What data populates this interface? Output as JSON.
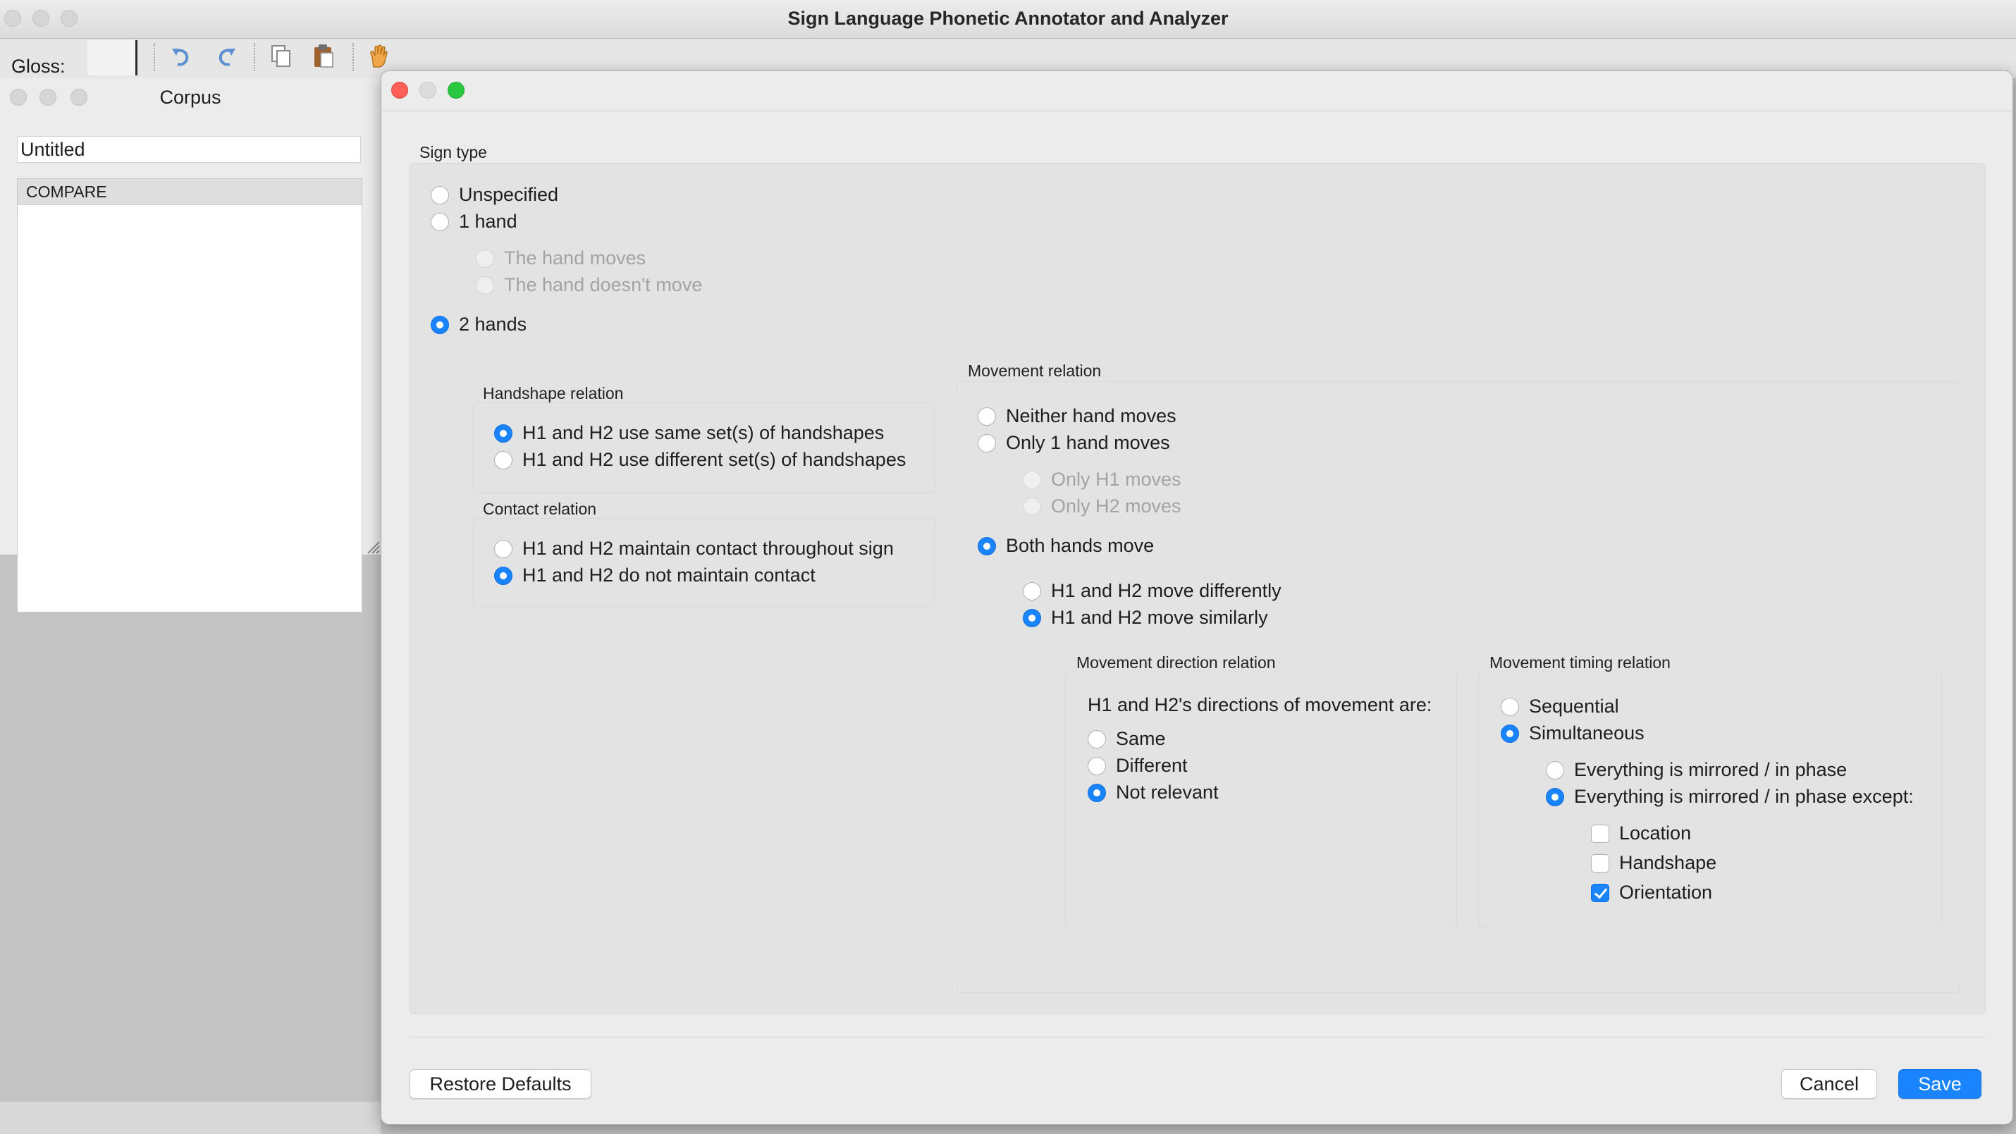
{
  "window": {
    "title": "Sign Language Phonetic Annotator and Analyzer"
  },
  "toolbar": {
    "gloss_label": "Gloss:",
    "icons": [
      "undo-icon",
      "redo-icon",
      "copy-icon",
      "paste-icon",
      "hand-icon"
    ]
  },
  "corpus": {
    "title": "Corpus",
    "name_value": "Untitled",
    "items": [
      "COMPARE"
    ]
  },
  "dialog": {
    "sign_type": {
      "label": "Sign type",
      "unspecified": "Unspecified",
      "one_hand": "1 hand",
      "hand_moves": "The hand moves",
      "hand_doesnt_move": "The hand doesn't move",
      "two_hands": "2 hands"
    },
    "handshape_relation": {
      "label": "Handshape relation",
      "same": "H1 and H2 use same set(s) of handshapes",
      "different": "H1 and H2 use different set(s) of handshapes"
    },
    "contact_relation": {
      "label": "Contact relation",
      "maintain": "H1 and H2 maintain contact throughout sign",
      "not_maintain": "H1 and H2 do not maintain contact"
    },
    "movement_relation": {
      "label": "Movement relation",
      "neither": "Neither hand moves",
      "only_one": "Only 1 hand moves",
      "only_h1": "Only H1 moves",
      "only_h2": "Only H2 moves",
      "both": "Both hands move",
      "differently": "H1 and H2 move differently",
      "similarly": "H1 and H2 move similarly"
    },
    "movement_direction": {
      "label": "Movement direction relation",
      "heading": "H1 and H2's directions of movement are:",
      "same": "Same",
      "different": "Different",
      "not_relevant": "Not relevant"
    },
    "movement_timing": {
      "label": "Movement timing relation",
      "sequential": "Sequential",
      "simultaneous": "Simultaneous",
      "mirrored": "Everything is mirrored / in phase",
      "mirrored_except": "Everything is mirrored / in phase except:",
      "location": "Location",
      "handshape": "Handshape",
      "orientation": "Orientation"
    },
    "buttons": {
      "restore": "Restore Defaults",
      "cancel": "Cancel",
      "save": "Save"
    }
  },
  "colors": {
    "accent": "#1a84ff",
    "close": "#fe5f57",
    "zoom": "#2ac840"
  }
}
